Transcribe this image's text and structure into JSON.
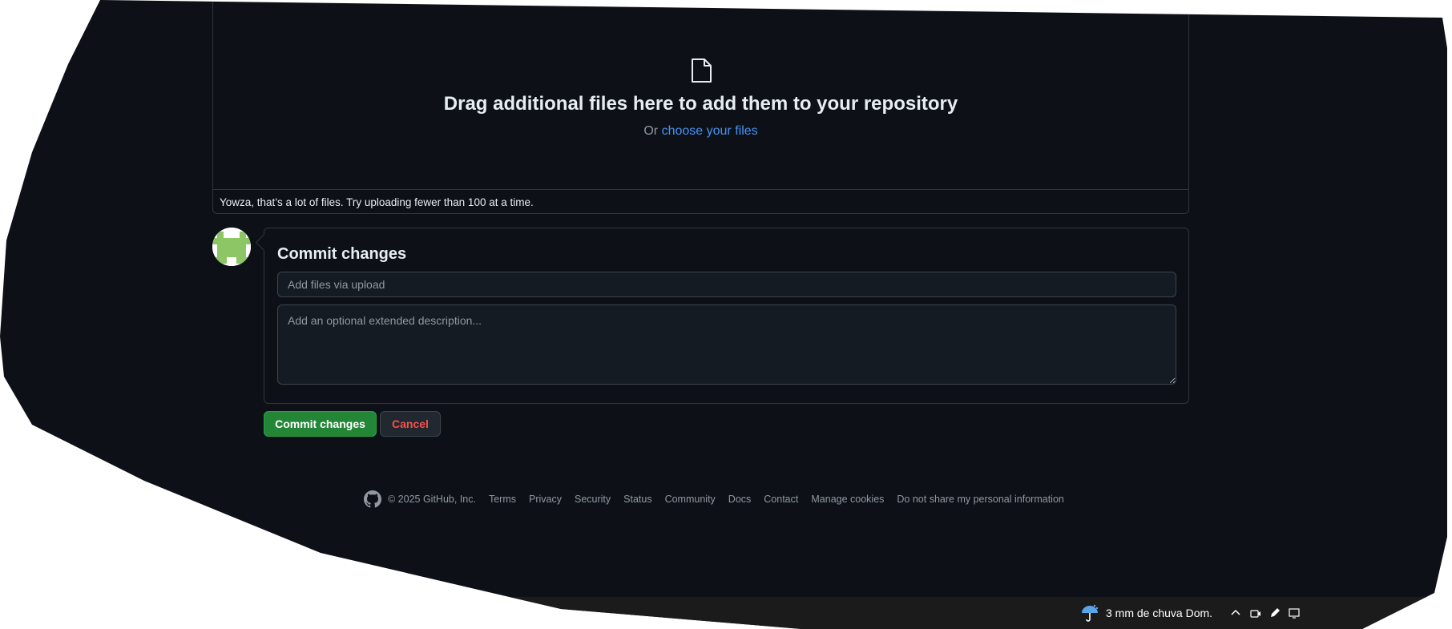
{
  "dropzone": {
    "title": "Drag additional files here to add them to your repository",
    "or_text": "Or ",
    "choose_link": "choose your files",
    "warning": "Yowza, that’s a lot of files. Try uploading fewer than 100 at a time."
  },
  "commit": {
    "heading": "Commit changes",
    "summary_placeholder": "Add files via upload",
    "summary_value": "",
    "description_placeholder": "Add an optional extended description...",
    "commit_button": "Commit changes",
    "cancel_button": "Cancel"
  },
  "footer": {
    "copyright": "© 2025 GitHub, Inc.",
    "links": [
      "Terms",
      "Privacy",
      "Security",
      "Status",
      "Community",
      "Docs",
      "Contact",
      "Manage cookies",
      "Do not share my personal information"
    ]
  },
  "taskbar": {
    "weather": "3 mm de chuva Dom."
  },
  "icons": [
    "file-icon",
    "github-mark-icon",
    "rain-umbrella-icon",
    "chevron-up-icon",
    "camera-icon",
    "pen-icon",
    "display-icon"
  ],
  "colors": {
    "background": "#0d1117",
    "border": "#30363d",
    "link": "#4493f8",
    "commit_green": "#238636",
    "cancel_red": "#f85149",
    "avatar_green": "#8cc665"
  }
}
